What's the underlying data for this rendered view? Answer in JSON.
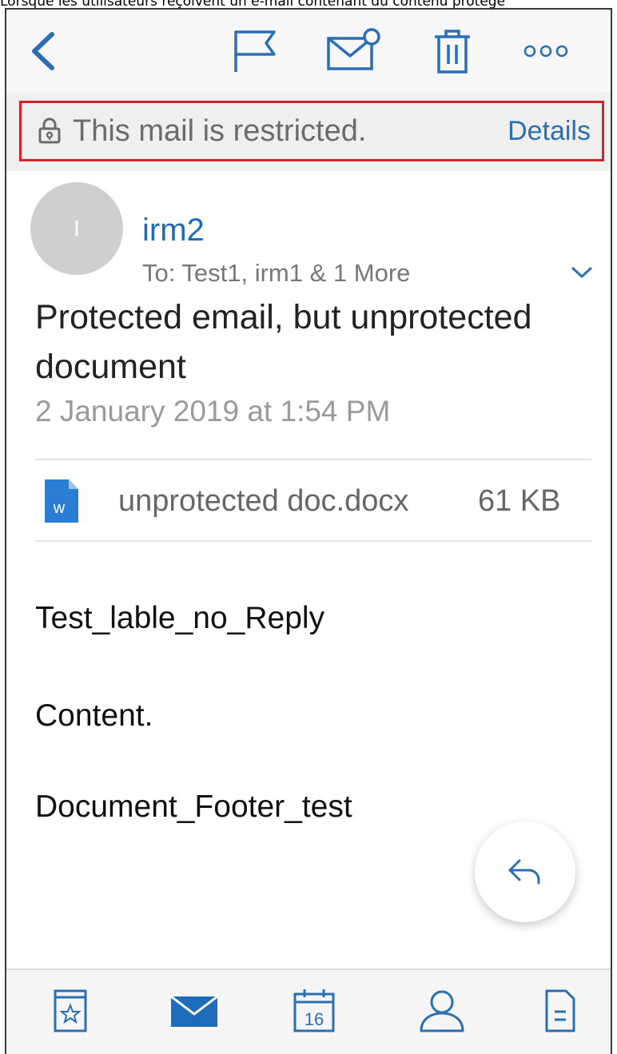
{
  "caption": "Lorsque les utilisateurs reçoivent un e-mail contenant du contenu protégé",
  "toolbar": {
    "back_icon": "chevron-left-icon",
    "flag_icon": "flag-icon",
    "mark_icon": "mail-unread-icon",
    "delete_icon": "trash-icon",
    "more_icon": "more-icon"
  },
  "banner": {
    "text": "This mail is restricted.",
    "details": "Details",
    "icon": "lock-icon"
  },
  "message": {
    "avatar_initial": "I",
    "sender": "irm2",
    "recipients": "To: Test1, irm1 & 1 More",
    "subject": "Protected email, but unprotected document",
    "date": "2 January 2019 at 1:54 PM"
  },
  "attachment": {
    "name": "unprotected doc.docx",
    "size": "61 KB",
    "icon_letter": "w"
  },
  "body": {
    "lines": [
      "Test_lable_no_Reply",
      "Content.",
      "Document_Footer_test"
    ]
  },
  "tabbar": {
    "items": [
      "favorites-icon",
      "mail-icon",
      "calendar-icon",
      "contacts-icon",
      "files-icon"
    ],
    "calendar_day": "16"
  },
  "colors": {
    "accent": "#2a6fb5",
    "banner_border": "#d2232a",
    "banner_bg": "#efefef",
    "word_blue": "#2b7cd3"
  }
}
